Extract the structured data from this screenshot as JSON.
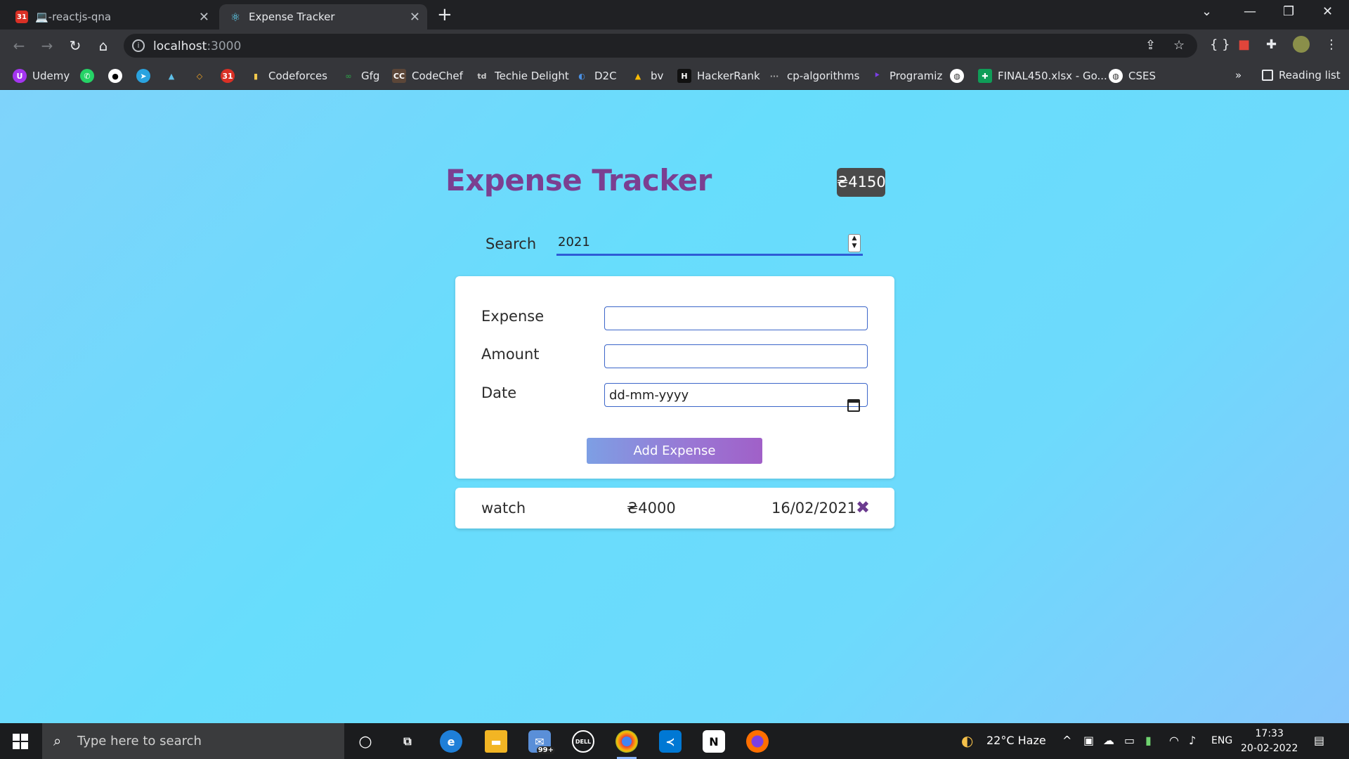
{
  "browser": {
    "tabs": [
      {
        "title": "💻-reactjs-qna",
        "active": false
      },
      {
        "title": "Expense Tracker",
        "active": true
      }
    ],
    "url_host": "localhost",
    "url_port": ":3000",
    "reading_list": "Reading list",
    "bookmarks": [
      "Udemy",
      "",
      "",
      "",
      "",
      "",
      "",
      "Codeforces",
      "Gfg",
      "CodeChef",
      "Techie Delight",
      "D2C",
      "bv",
      "HackerRank",
      "cp-algorithms",
      "Programiz",
      "",
      "FINAL450.xlsx - Go...",
      "CSES"
    ],
    "bookmark_more": "»"
  },
  "app": {
    "title": "Expense Tracker",
    "total": "₴4150",
    "search_label": "Search",
    "search_value": "2021",
    "form": {
      "expense_label": "Expense",
      "amount_label": "Amount",
      "date_label": "Date",
      "date_placeholder": "dd-mm-yyyy",
      "add_button": "Add Expense"
    },
    "expenses": [
      {
        "name": "watch",
        "amount": "₴4000",
        "date": "16/02/2021",
        "delete": "✖"
      }
    ]
  },
  "taskbar": {
    "search_placeholder": "Type here to search",
    "weather": "22°C  Haze",
    "language": "ENG",
    "time": "17:33",
    "date": "20-02-2022",
    "mail_badge": "99+"
  },
  "colors": {
    "title": "#7b3f91",
    "accent_underline": "#2e5bd6",
    "badge_bg": "#4a4a4a"
  }
}
